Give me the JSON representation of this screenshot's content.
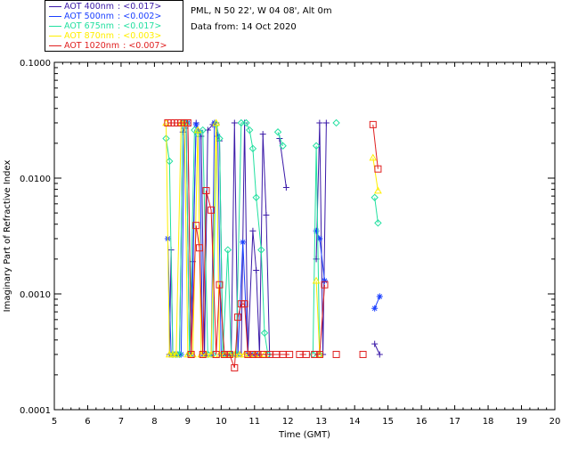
{
  "legend": [
    {
      "name": "AOT  400nm",
      "value": ": <0.017>",
      "color": "#3b1aa8"
    },
    {
      "name": "AOT  500nm",
      "value": ": <0.002>",
      "color": "#1a3fff"
    },
    {
      "name": "AOT  675nm",
      "value": ": <0.017>",
      "color": "#22e0a0"
    },
    {
      "name": "AOT  870nm",
      "value": ": <0.003>",
      "color": "#ffee00"
    },
    {
      "name": "AOT 1020nm",
      "value": ": <0.007>",
      "color": "#e02020"
    }
  ],
  "info": {
    "location": "PML, N 50 22', W 04 08', Alt 0m",
    "date": "Data from: 14 Oct 2020"
  },
  "chart_data": {
    "type": "line",
    "xlabel": "Time (GMT)",
    "ylabel": "Imaginary Part of Refractive Index",
    "xlim": [
      5,
      20
    ],
    "ylim": [
      0.0001,
      0.1
    ],
    "yscale": "log",
    "xticks": [
      "5",
      "6",
      "7",
      "8",
      "9",
      "10",
      "11",
      "12",
      "13",
      "14",
      "15",
      "16",
      "17",
      "18",
      "19",
      "20"
    ],
    "yticks": [
      "0.0001",
      "0.0010",
      "0.0100",
      "0.1000"
    ],
    "series": [
      {
        "name": "AOT  400nm",
        "color": "#3b1aa8",
        "marker": "plus",
        "segments": [
          [
            [
              8.45,
              0.0003
            ],
            [
              8.5,
              0.0024
            ],
            [
              8.55,
              0.0003
            ],
            [
              8.65,
              0.0003
            ],
            [
              8.75,
              0.0003
            ],
            [
              8.85,
              0.025
            ],
            [
              8.9,
              0.027
            ],
            [
              8.95,
              0.03
            ],
            [
              9.05,
              0.0003
            ],
            [
              9.15,
              0.0019
            ],
            [
              9.25,
              0.03
            ],
            [
              9.4,
              0.023
            ],
            [
              9.5,
              0.0003
            ],
            [
              9.6,
              0.026
            ],
            [
              9.75,
              0.029
            ],
            [
              9.85,
              0.03
            ],
            [
              9.95,
              0.021
            ],
            [
              10.05,
              0.0003
            ],
            [
              10.15,
              0.0003
            ],
            [
              10.3,
              0.0003
            ],
            [
              10.4,
              0.03
            ],
            [
              10.5,
              0.0003
            ],
            [
              10.6,
              0.0003
            ],
            [
              10.7,
              0.03
            ],
            [
              10.8,
              0.0003
            ],
            [
              10.95,
              0.0035
            ],
            [
              11.05,
              0.0016
            ],
            [
              11.15,
              0.0003
            ],
            [
              11.25,
              0.024
            ],
            [
              11.35,
              0.0048
            ],
            [
              11.45,
              0.0003
            ]
          ],
          [
            [
              11.75,
              0.022
            ],
            [
              11.95,
              0.0083
            ]
          ],
          [
            [
              12.85,
              0.002
            ],
            [
              12.95,
              0.03
            ],
            [
              13.05,
              0.0003
            ],
            [
              13.15,
              0.03
            ]
          ],
          [
            [
              14.6,
              0.00037
            ],
            [
              14.75,
              0.0003
            ]
          ]
        ]
      },
      {
        "name": "AOT  500nm",
        "color": "#1a3fff",
        "marker": "asterisk",
        "segments": [
          [
            [
              8.4,
              0.003
            ],
            [
              8.5,
              0.0003
            ],
            [
              8.6,
              0.0003
            ],
            [
              8.7,
              0.0003
            ],
            [
              8.8,
              0.0003
            ],
            [
              8.9,
              0.03
            ],
            [
              9.0,
              0.03
            ],
            [
              9.1,
              0.0003
            ],
            [
              9.25,
              0.029
            ],
            [
              9.35,
              0.025
            ],
            [
              9.45,
              0.0003
            ],
            [
              9.55,
              0.0003
            ],
            [
              9.7,
              0.0003
            ],
            [
              9.8,
              0.03
            ],
            [
              9.9,
              0.023
            ],
            [
              10.0,
              0.0003
            ],
            [
              10.1,
              0.0003
            ],
            [
              10.25,
              0.0003
            ],
            [
              10.35,
              0.0003
            ],
            [
              10.5,
              0.0003
            ],
            [
              10.65,
              0.0028
            ],
            [
              10.8,
              0.0003
            ],
            [
              10.95,
              0.0003
            ],
            [
              11.1,
              0.0003
            ]
          ],
          [
            [
              12.85,
              0.0035
            ],
            [
              12.95,
              0.003
            ],
            [
              13.1,
              0.0013
            ]
          ],
          [
            [
              14.6,
              0.00075
            ],
            [
              14.75,
              0.00095
            ]
          ]
        ]
      },
      {
        "name": "AOT  675nm",
        "color": "#22e0a0",
        "marker": "diamond",
        "segments": [
          [
            [
              8.35,
              0.022
            ],
            [
              8.45,
              0.014
            ],
            [
              8.55,
              0.0003
            ],
            [
              8.65,
              0.0003
            ],
            [
              8.75,
              0.0003
            ],
            [
              8.85,
              0.03
            ],
            [
              8.95,
              0.03
            ],
            [
              9.05,
              0.0003
            ],
            [
              9.2,
              0.026
            ],
            [
              9.3,
              0.024
            ],
            [
              9.45,
              0.026
            ],
            [
              9.6,
              0.0003
            ],
            [
              9.75,
              0.0003
            ],
            [
              9.85,
              0.029
            ],
            [
              9.95,
              0.022
            ],
            [
              10.05,
              0.0003
            ],
            [
              10.2,
              0.0024
            ],
            [
              10.3,
              0.0003
            ],
            [
              10.45,
              0.0003
            ],
            [
              10.6,
              0.03
            ],
            [
              10.75,
              0.03
            ],
            [
              10.85,
              0.026
            ],
            [
              10.95,
              0.018
            ],
            [
              11.05,
              0.0068
            ],
            [
              11.2,
              0.0024
            ],
            [
              11.3,
              0.00046
            ],
            [
              11.4,
              0.0003
            ]
          ],
          [
            [
              11.7,
              0.025
            ],
            [
              11.85,
              0.019
            ]
          ],
          [
            [
              12.75,
              0.0003
            ],
            [
              12.85,
              0.019
            ],
            [
              12.95,
              0.0003
            ]
          ],
          [
            [
              13.45,
              0.03
            ]
          ],
          [
            [
              14.6,
              0.0068
            ],
            [
              14.7,
              0.0041
            ]
          ]
        ]
      },
      {
        "name": "AOT  870nm",
        "color": "#ffee00",
        "marker": "triangle",
        "segments": [
          [
            [
              8.35,
              0.03
            ],
            [
              8.45,
              0.0003
            ],
            [
              8.55,
              0.0003
            ],
            [
              8.65,
              0.0003
            ],
            [
              8.8,
              0.03
            ],
            [
              8.9,
              0.03
            ],
            [
              9.0,
              0.0003
            ],
            [
              9.15,
              0.0003
            ],
            [
              9.3,
              0.026
            ],
            [
              9.4,
              0.0003
            ],
            [
              9.55,
              0.0003
            ],
            [
              9.7,
              0.0003
            ],
            [
              9.85,
              0.03
            ],
            [
              9.95,
              0.0003
            ],
            [
              10.1,
              0.0003
            ],
            [
              10.25,
              0.0003
            ],
            [
              10.4,
              0.0003
            ],
            [
              10.55,
              0.0003
            ],
            [
              10.7,
              0.0003
            ],
            [
              10.85,
              0.0003
            ],
            [
              11.0,
              0.0003
            ],
            [
              11.15,
              0.0003
            ],
            [
              11.3,
              0.0003
            ]
          ],
          [
            [
              12.85,
              0.0013
            ],
            [
              12.95,
              0.0003
            ]
          ],
          [
            [
              14.55,
              0.015
            ],
            [
              14.7,
              0.0078
            ]
          ]
        ]
      },
      {
        "name": "AOT 1020nm",
        "color": "#e02020",
        "marker": "square",
        "segments": [
          [
            [
              8.4,
              0.03
            ],
            [
              8.5,
              0.03
            ],
            [
              8.6,
              0.03
            ],
            [
              8.7,
              0.03
            ],
            [
              8.8,
              0.03
            ],
            [
              8.9,
              0.03
            ],
            [
              9.0,
              0.03
            ],
            [
              9.1,
              0.0003
            ],
            [
              9.25,
              0.0039
            ],
            [
              9.35,
              0.0025
            ],
            [
              9.45,
              0.0003
            ],
            [
              9.55,
              0.0078
            ],
            [
              9.7,
              0.0053
            ],
            [
              9.85,
              0.0003
            ],
            [
              9.95,
              0.0012
            ],
            [
              10.1,
              0.0003
            ],
            [
              10.25,
              0.0003
            ],
            [
              10.4,
              0.00023
            ],
            [
              10.5,
              0.00063
            ],
            [
              10.6,
              0.00082
            ],
            [
              10.7,
              0.00082
            ],
            [
              10.8,
              0.0003
            ],
            [
              10.95,
              0.0003
            ],
            [
              11.1,
              0.0003
            ],
            [
              11.25,
              0.0003
            ],
            [
              11.45,
              0.0003
            ],
            [
              11.65,
              0.0003
            ],
            [
              11.85,
              0.0003
            ],
            [
              12.05,
              0.0003
            ]
          ],
          [
            [
              12.35,
              0.0003
            ],
            [
              12.55,
              0.0003
            ]
          ],
          [
            [
              12.8,
              0.0003
            ],
            [
              12.95,
              0.0003
            ],
            [
              13.1,
              0.0012
            ]
          ],
          [
            [
              13.45,
              0.0003
            ]
          ],
          [
            [
              14.25,
              0.0003
            ]
          ],
          [
            [
              14.55,
              0.029
            ],
            [
              14.7,
              0.012
            ]
          ]
        ]
      }
    ]
  }
}
